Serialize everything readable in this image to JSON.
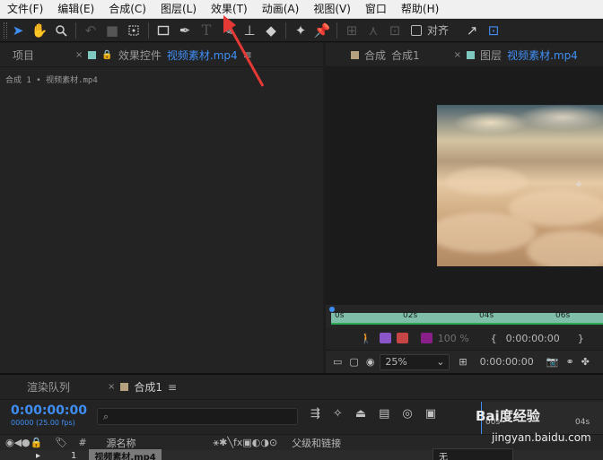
{
  "menubar": {
    "items": [
      "文件(F)",
      "编辑(E)",
      "合成(C)",
      "图层(L)",
      "效果(T)",
      "动画(A)",
      "视图(V)",
      "窗口",
      "帮助(H)"
    ]
  },
  "toolbar": {
    "snap_label": "对齐"
  },
  "left_panel": {
    "tab_project": "项目",
    "tab_effects_prefix": "效果控件",
    "tab_effects_file": "视频素材.mp4",
    "breadcrumb": "合成 1 • 视频素材.mp4"
  },
  "right_panel": {
    "tab_comp_prefix": "合成",
    "tab_comp_name": "合成1",
    "tab_layer_prefix": "图层",
    "tab_layer_file": "视频素材.mp4",
    "ruler_labels": [
      "0s",
      "02s",
      "04s",
      "06s"
    ],
    "opacity_value": "100 %",
    "time_in": "0:00:00:00",
    "time_out": "0:00:00:00",
    "zoom": "25%",
    "current_time": "0:00:00:00"
  },
  "timeline": {
    "tab_render": "渲染队列",
    "tab_comp": "合成1",
    "timecode": "0:00:00:00",
    "fps": "00000 (25.00 fps)",
    "search_placeholder": "",
    "ruler_start": "00s",
    "ruler_end": "04s",
    "col_hash": "#",
    "col_source": "源名称",
    "col_parent": "父级和链接",
    "layer_index": "1",
    "layer_name": "视频素材.mp4",
    "layer_parent": "无"
  },
  "colors": {
    "accent_blue": "#3f8ef5",
    "annotation_red": "#e53935",
    "ruler_green": "#7fbfa9"
  },
  "watermark": {
    "title": "Bai度经验",
    "url": "jingyan.baidu.com"
  }
}
